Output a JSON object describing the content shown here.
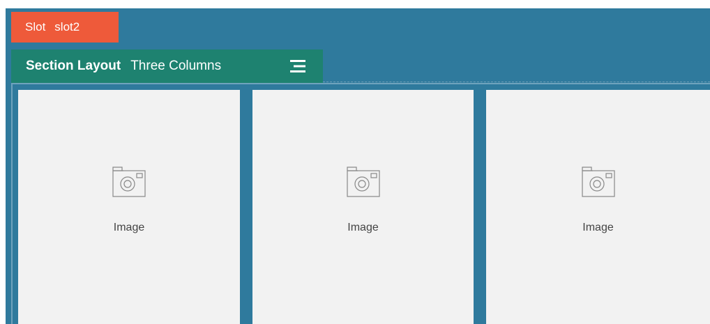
{
  "slot": {
    "label": "Slot",
    "name": "slot2"
  },
  "section": {
    "label": "Section Layout",
    "value": "Three Columns",
    "menu_icon": "hamburger-menu-icon"
  },
  "columns": [
    {
      "label": "Image",
      "icon": "camera-icon"
    },
    {
      "label": "Image",
      "icon": "camera-icon"
    },
    {
      "label": "Image",
      "icon": "camera-icon"
    }
  ],
  "colors": {
    "slot_tab": "#ee5a3a",
    "slot_background": "#2f7a9d",
    "section_bar": "#1e8270",
    "column_background": "#f2f2f2"
  }
}
